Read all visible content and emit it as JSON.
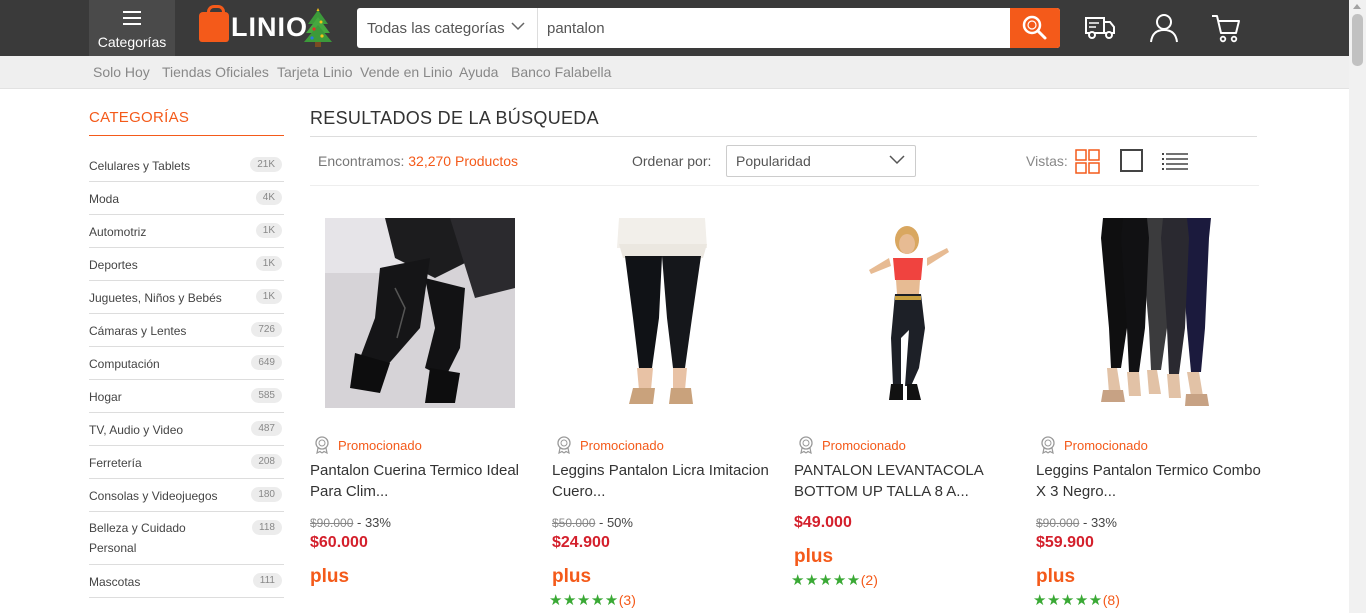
{
  "header": {
    "categories_label": "Categorías",
    "logo_text": "LINIO",
    "search": {
      "category_selected": "Todas las categorías",
      "query": "pantalon"
    }
  },
  "subnav": {
    "links": [
      "Solo Hoy",
      "Tiendas Oficiales",
      "Tarjeta Linio",
      "Vende en Linio",
      "Ayuda",
      "Banco Falabella"
    ]
  },
  "sidebar": {
    "title": "CATEGORÍAS",
    "items": [
      {
        "label": "Celulares y Tablets",
        "count": "21K"
      },
      {
        "label": "Moda",
        "count": "4K"
      },
      {
        "label": "Automotriz",
        "count": "1K"
      },
      {
        "label": "Deportes",
        "count": "1K"
      },
      {
        "label": "Juguetes, Niños y Bebés",
        "count": "1K"
      },
      {
        "label": "Cámaras y Lentes",
        "count": "726"
      },
      {
        "label": "Computación",
        "count": "649"
      },
      {
        "label": "Hogar",
        "count": "585"
      },
      {
        "label": "TV, Audio y Video",
        "count": "487"
      },
      {
        "label": "Ferretería",
        "count": "208"
      },
      {
        "label": "Consolas y Videojuegos",
        "count": "180"
      },
      {
        "label": "Belleza y Cuidado Personal",
        "count": "118"
      },
      {
        "label": "Mascotas",
        "count": "111"
      }
    ]
  },
  "results": {
    "title": "RESULTADOS DE LA BÚSQUEDA",
    "found_prefix": "Encontramos:",
    "found_count": "32,270 Productos",
    "order_label": "Ordenar por:",
    "order_value": "Popularidad",
    "views_label": "Vistas:"
  },
  "products": [
    {
      "promo": "Promocionado",
      "name": "Pantalon Cuerina Termico Ideal Para Clim...",
      "old_price": "$90.000",
      "discount": "- 33%",
      "price": "$60.000",
      "plus": "plus",
      "stars": "",
      "rating_count": ""
    },
    {
      "promo": "Promocionado",
      "name": "Leggins Pantalon Licra Imitacion Cuero...",
      "old_price": "$50.000",
      "discount": "- 50%",
      "price": "$24.900",
      "plus": "plus",
      "stars": "★★★★★",
      "rating_count": "(3)"
    },
    {
      "promo": "Promocionado",
      "name": "PANTALON LEVANTACOLA BOTTOM UP TALLA 8 A...",
      "old_price": "",
      "discount": "",
      "price": "$49.000",
      "plus": "plus",
      "stars": "★★★★★",
      "rating_count": "(2)"
    },
    {
      "promo": "Promocionado",
      "name": "Leggins Pantalon Termico Combo X 3 Negro...",
      "old_price": "$90.000",
      "discount": "- 33%",
      "price": "$59.900",
      "plus": "plus",
      "stars": "★★★★★",
      "rating_count": "(8)"
    }
  ],
  "colors": {
    "brand": "#f45a1a",
    "price": "#d4202c",
    "stars": "#3aa935",
    "header": "#3a3a3a"
  }
}
